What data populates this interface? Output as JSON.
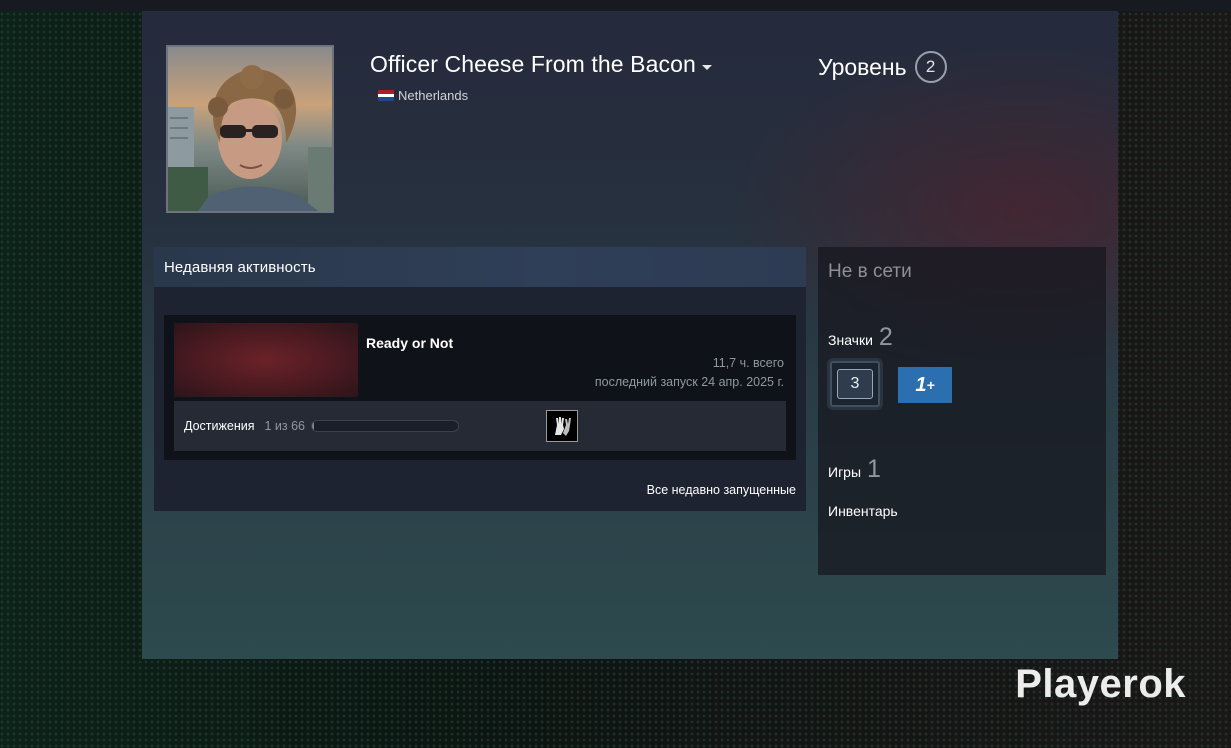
{
  "profile": {
    "persona_name": "Officer Cheese From the Bacon",
    "country": "Netherlands",
    "level_label": "Уровень",
    "level_value": "2"
  },
  "activity": {
    "title": "Недавняя активность",
    "game": {
      "name": "Ready or Not",
      "hours": "11,7 ч. всего",
      "last_played": "последний запуск 24 апр. 2025 г.",
      "achievements_label": "Достижения",
      "achievements_count": "1 из 66",
      "achievements_progress": 0.015
    },
    "view_all": "Все недавно запущенные"
  },
  "sidebar": {
    "status": "Не в сети",
    "badges_label": "Значки",
    "badges_count": "2",
    "badge1_text": "3",
    "badge2_text": "1",
    "badge2_suffix": "+",
    "games_label": "Игры",
    "games_count": "1",
    "inventory_label": "Инвентарь"
  },
  "watermark": "Playerok",
  "colors": {
    "accent_blue": "#2b6fb0",
    "flag_red": "#ae1c28",
    "flag_white": "#ffffff",
    "flag_blue": "#21468b"
  }
}
